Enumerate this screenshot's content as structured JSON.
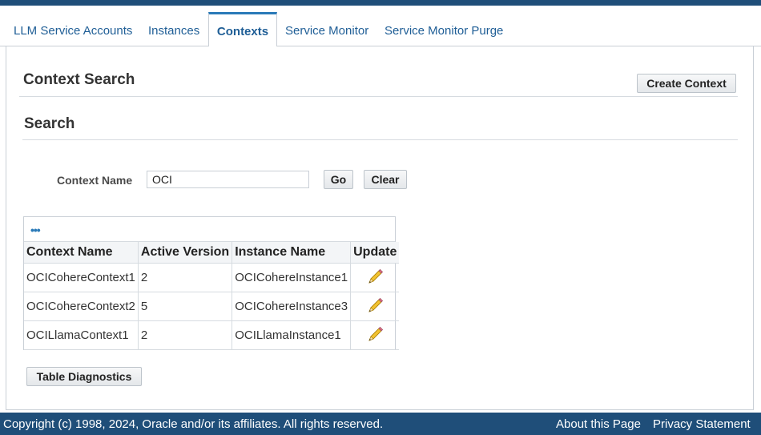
{
  "tabs": [
    {
      "label": "LLM Service Accounts"
    },
    {
      "label": "Instances"
    },
    {
      "label": "Contexts",
      "active": true
    },
    {
      "label": "Service Monitor"
    },
    {
      "label": "Service Monitor Purge"
    }
  ],
  "page": {
    "title": "Context Search",
    "create_button": "Create Context"
  },
  "search": {
    "heading": "Search",
    "context_name_label": "Context Name",
    "context_name_value": "OCI",
    "go_button": "Go",
    "clear_button": "Clear"
  },
  "table": {
    "columns": [
      "Context Name",
      "Active Version",
      "Instance Name",
      "Update"
    ],
    "rows": [
      {
        "context_name": "OCICohereContext1",
        "active_version": "2",
        "instance_name": "OCICohereInstance1"
      },
      {
        "context_name": "OCICohereContext2",
        "active_version": "5",
        "instance_name": "OCICohereInstance3"
      },
      {
        "context_name": "OCILlamaContext1",
        "active_version": "2",
        "instance_name": "OCILlamaInstance1"
      }
    ],
    "diagnostics_button": "Table Diagnostics"
  },
  "footer": {
    "copyright": "Copyright (c) 1998, 2024, Oracle and/or its affiliates. All rights reserved.",
    "about_link": "About this Page",
    "privacy_link": "Privacy Statement"
  },
  "colors": {
    "banner": "#1f4e79",
    "link": "#1f5e96",
    "accent": "#2a7ab8"
  },
  "icons": {
    "update": "pencil-icon",
    "table_actions": "more-options-icon"
  }
}
